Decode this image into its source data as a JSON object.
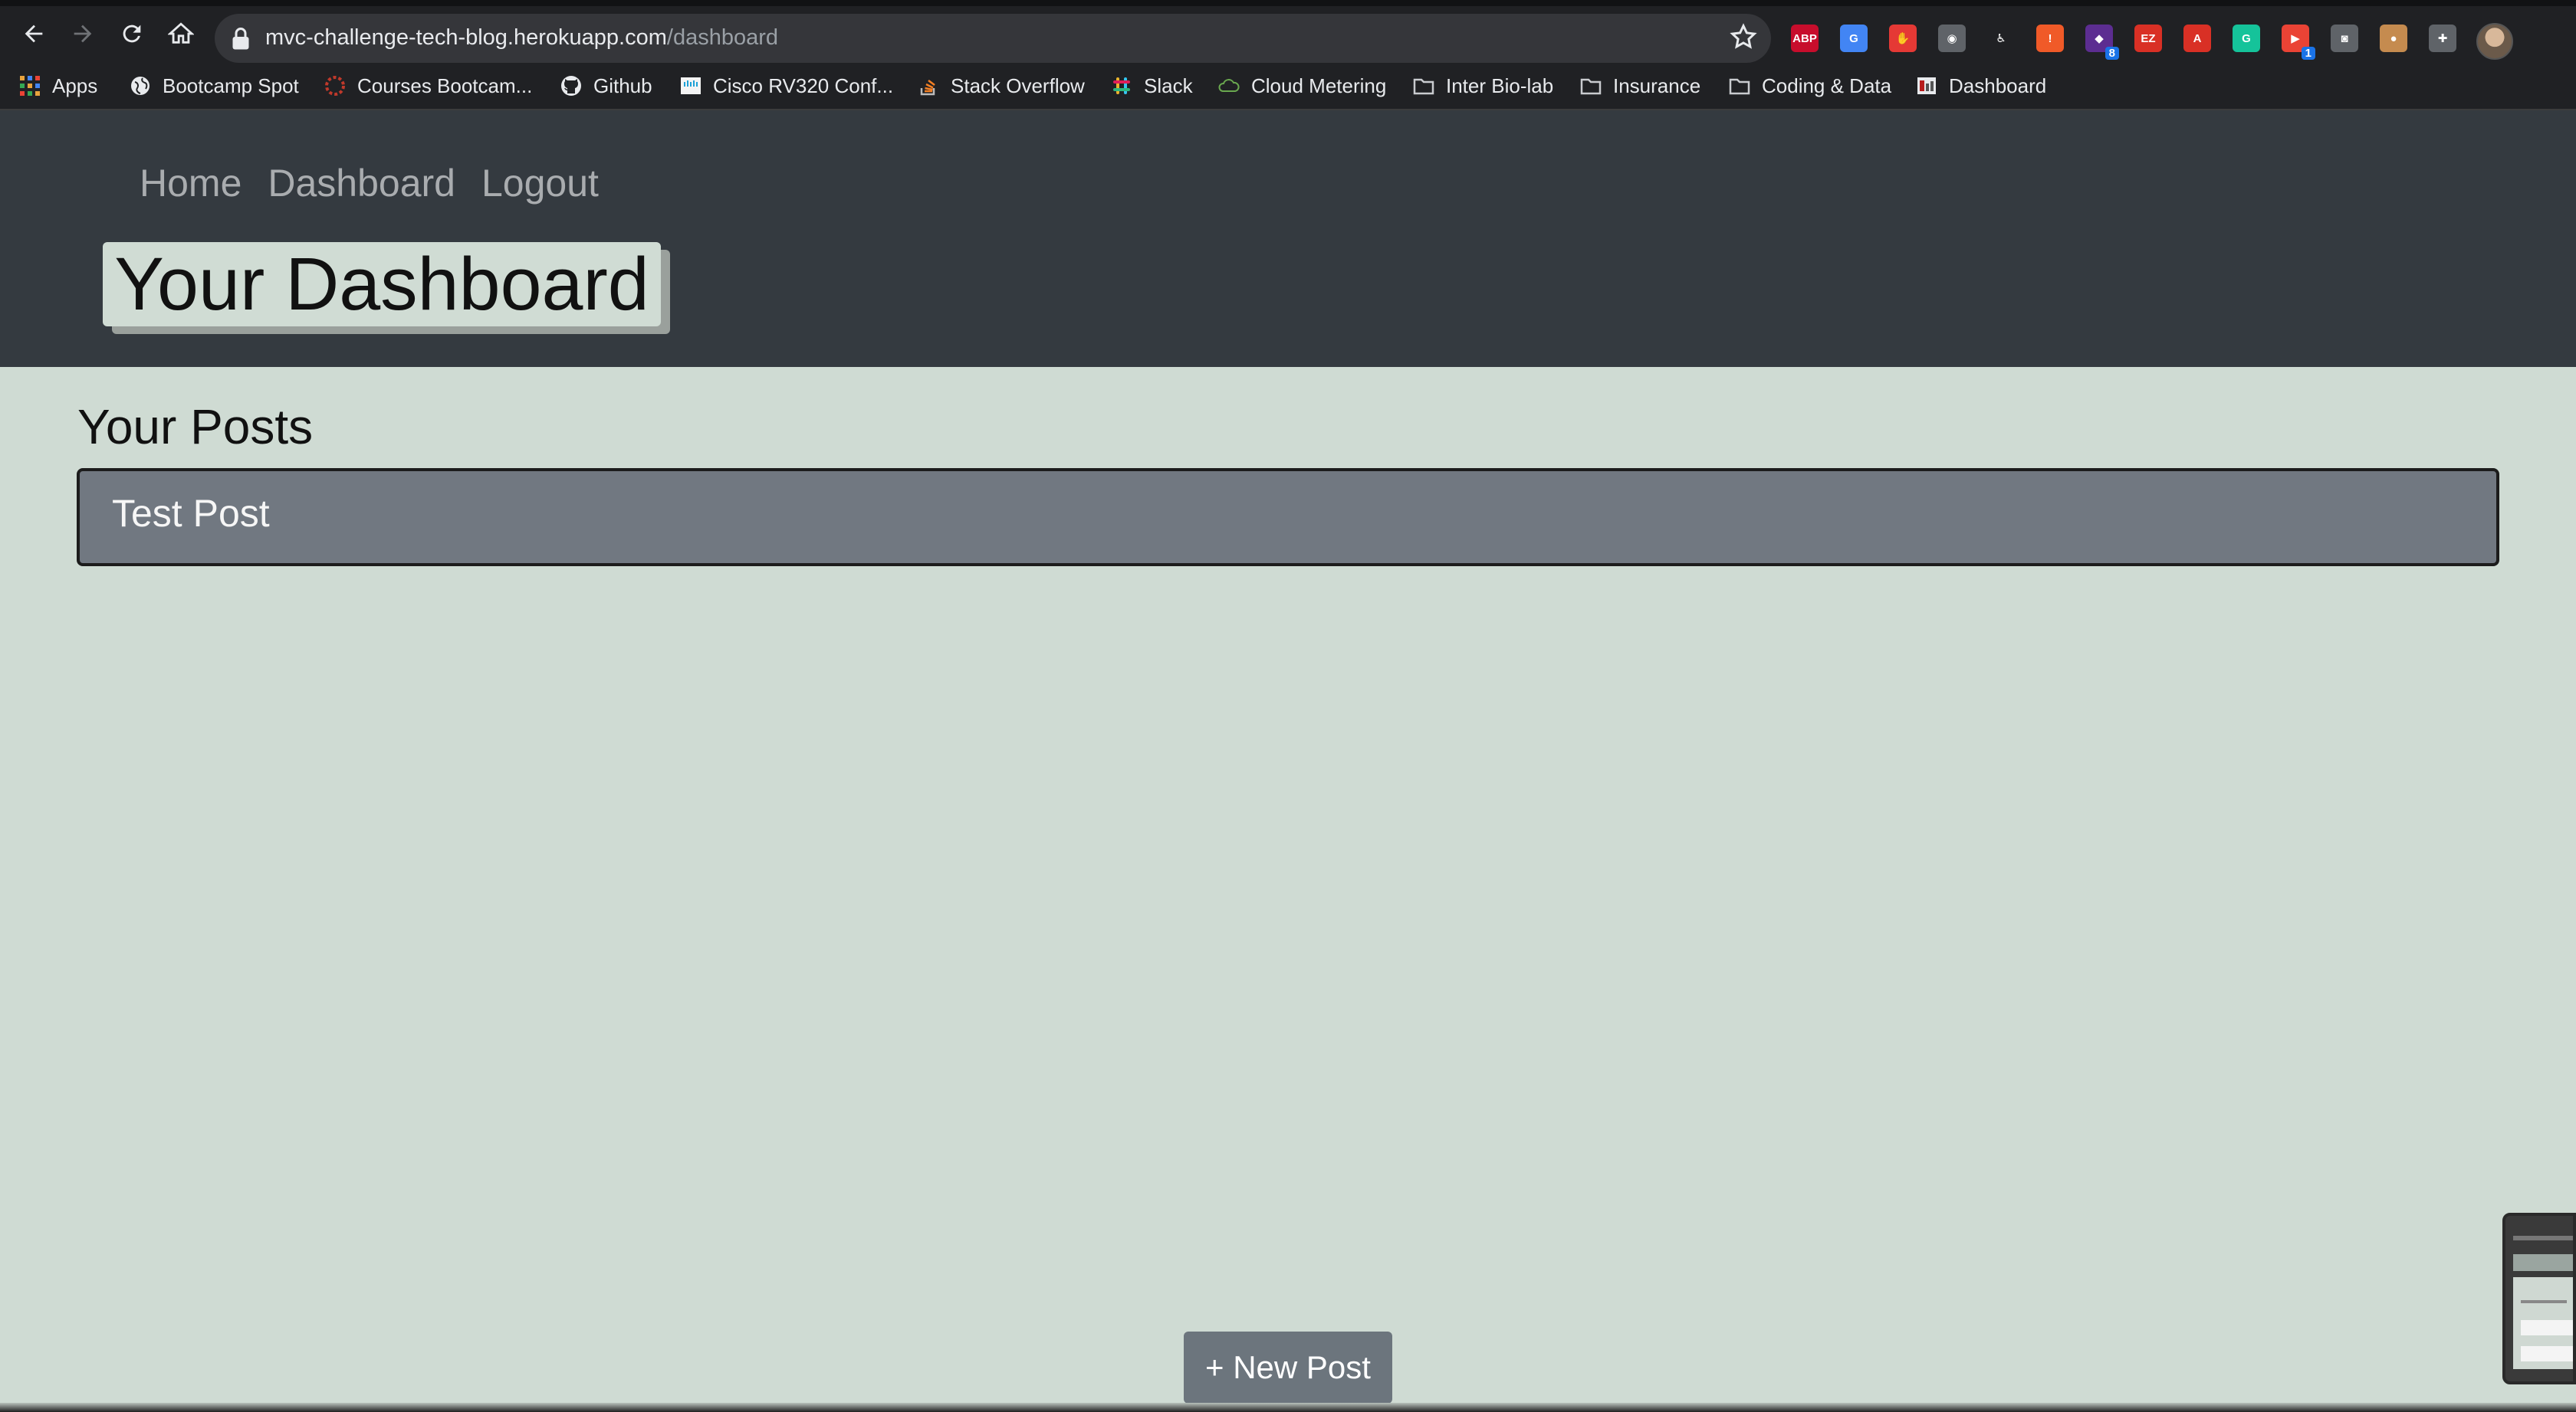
{
  "browser": {
    "url_host": "mvc-challenge-tech-blog.herokuapp.com",
    "url_path": "/dashboard",
    "extensions": [
      {
        "name": "adblock-plus-icon",
        "text": "ABP",
        "color": "#c70d2c"
      },
      {
        "name": "google-translate-icon",
        "text": "G",
        "color": "#4285f4"
      },
      {
        "name": "stop-hand-icon",
        "text": "✋",
        "color": "#e53935"
      },
      {
        "name": "circle-extension-icon",
        "text": "◉",
        "color": "#5f6368"
      },
      {
        "name": "person-run-icon",
        "text": "♿",
        "color": "#202124"
      },
      {
        "name": "alert-extension-icon",
        "text": "!",
        "color": "#f05a28"
      },
      {
        "name": "purple-extension-icon",
        "text": "◆",
        "color": "#5c2d91",
        "count": "8"
      },
      {
        "name": "ez-extension-icon",
        "text": "EZ",
        "color": "#d93025"
      },
      {
        "name": "pdf-icon",
        "text": "A",
        "color": "#d93025"
      },
      {
        "name": "grammarly-icon",
        "text": "G",
        "color": "#15c39a"
      },
      {
        "name": "screencast-icon",
        "text": "▶",
        "color": "#ea4335",
        "count": "1"
      },
      {
        "name": "camera-icon",
        "text": "◙",
        "color": "#5f6368"
      },
      {
        "name": "cookie-icon",
        "text": "●",
        "color": "#c58b4f"
      },
      {
        "name": "puzzle-icon",
        "text": "✚",
        "color": "#5f6368"
      }
    ],
    "bookmarks": [
      {
        "name": "bookmark-apps",
        "label": "Apps",
        "icon": "apps-grid-icon"
      },
      {
        "name": "bookmark-bootcamp-spot",
        "label": "Bootcamp Spot",
        "icon": "globe-icon"
      },
      {
        "name": "bookmark-courses",
        "label": "Courses Bootcam...",
        "icon": "gear-ring-icon"
      },
      {
        "name": "bookmark-github",
        "label": "Github",
        "icon": "github-icon"
      },
      {
        "name": "bookmark-cisco",
        "label": "Cisco RV320 Conf...",
        "icon": "cisco-icon"
      },
      {
        "name": "bookmark-stack-overflow",
        "label": "Stack Overflow",
        "icon": "stack-overflow-icon"
      },
      {
        "name": "bookmark-slack",
        "label": "Slack",
        "icon": "slack-icon"
      },
      {
        "name": "bookmark-cloud-metering",
        "label": "Cloud Metering",
        "icon": "cloud-metering-icon"
      },
      {
        "name": "bookmark-inter-bio-lab",
        "label": "Inter Bio-lab",
        "icon": "folder-icon"
      },
      {
        "name": "bookmark-insurance",
        "label": "Insurance",
        "icon": "folder-icon"
      },
      {
        "name": "bookmark-coding-data",
        "label": "Coding & Data",
        "icon": "folder-icon"
      },
      {
        "name": "bookmark-dashboard",
        "label": "Dashboard",
        "icon": "dashboard-icon"
      }
    ]
  },
  "nav": {
    "home": "Home",
    "dashboard": "Dashboard",
    "logout": "Logout"
  },
  "page": {
    "title": "Your Dashboard",
    "section_title": "Your Posts",
    "posts": [
      {
        "title": "Test Post"
      }
    ],
    "new_post_label": "+ New Post"
  },
  "colors": {
    "header_bg": "#343a40",
    "page_bg": "#cfdbd3",
    "post_card_bg": "#717881",
    "button_bg": "#6c757d"
  }
}
